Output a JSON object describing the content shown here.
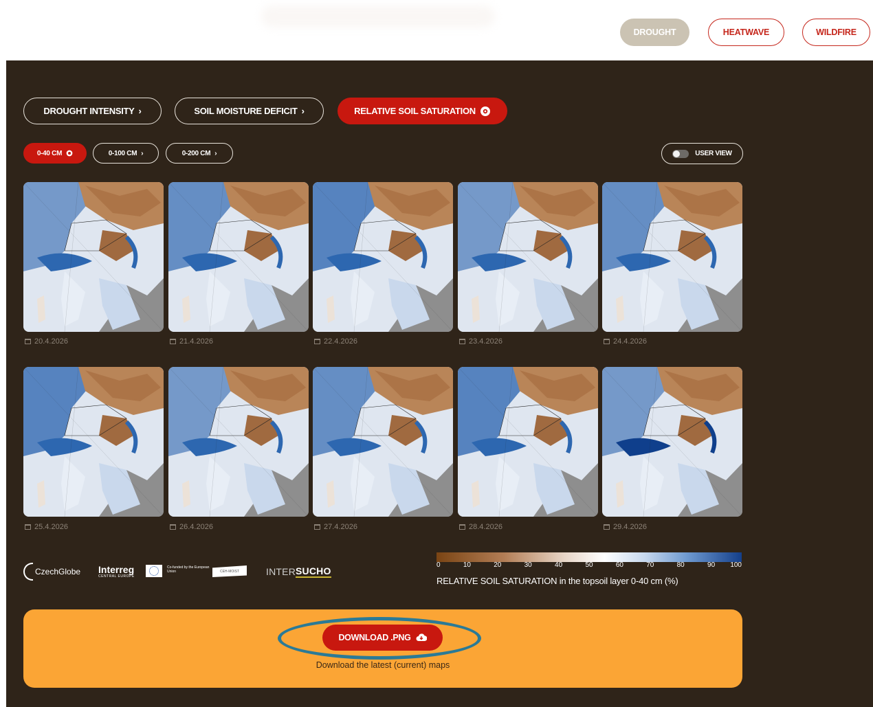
{
  "hazard_tabs": [
    "DROUGHT",
    "HEATWAVE",
    "WILDFIRE"
  ],
  "metric_tabs": {
    "drought_intensity": "DROUGHT INTENSITY",
    "soil_moisture_deficit": "SOIL MOISTURE DEFICIT",
    "relative_soil_saturation": "RELATIVE SOIL SATURATION"
  },
  "depth_tabs": {
    "d40": "0-40 CM",
    "d100": "0-100 CM",
    "d200": "0-200 CM"
  },
  "user_view_label": "USER VIEW",
  "map_dates": [
    "20.4.2026",
    "21.4.2026",
    "22.4.2026",
    "23.4.2026",
    "24.4.2026",
    "25.4.2026",
    "26.4.2026",
    "27.4.2026",
    "28.4.2026",
    "29.4.2026"
  ],
  "logos": {
    "czechglobe": "CzechGlobe",
    "interreg": "Interreg",
    "interreg_sub": "CENTRAL EUROPE",
    "cofunded": "Co-funded by the European Union",
    "climacore": "CEH-MOIST",
    "intersucho_a": "INTER",
    "intersucho_b": "SUCHO"
  },
  "legend": {
    "ticks": [
      "0",
      "10",
      "20",
      "30",
      "40",
      "50",
      "60",
      "70",
      "80",
      "90",
      "100"
    ],
    "title": "RELATIVE SOIL SATURATION in the topsoil layer 0-40 cm (%)",
    "colors": [
      "#7a4413",
      "#e8d6c7",
      "#ffffff",
      "#6f9ad0",
      "#143f8a"
    ]
  },
  "download": {
    "button": "DOWNLOAD .PNG",
    "caption": "Download the latest (current) maps"
  },
  "colors": {
    "active_red": "#c8180f",
    "panel_bg": "#2f2419",
    "download_bg": "#fba535"
  }
}
